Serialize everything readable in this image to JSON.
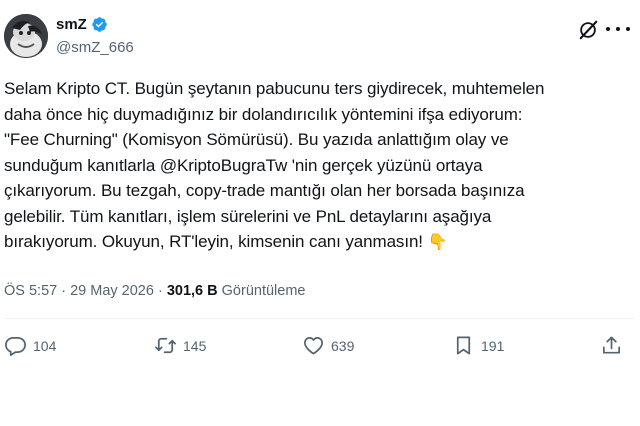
{
  "author": {
    "name": "smZ",
    "handle": "@smZ_666"
  },
  "post": {
    "lines": [
      "Selam Kripto CT. Bugün şeytanın pabucunu ters giydirecek, muhtemelen",
      "daha önce hiç duymadığınız bir dolandırıcılık yöntemini ifşa ediyorum:",
      "\"Fee Churning\" (Komisyon Sömürüsü). Bu yazıda anlattığım olay ve",
      "sunduğum kanıtlarla @KriptoBugraTw 'nin gerçek yüzünü ortaya",
      "çıkarıyorum. Bu tezgah, copy-trade mantığı olan her borsada başınıza",
      "gelebilir. Tüm kanıtları, işlem sürelerini ve PnL detaylarını aşağıya",
      "bırakıyorum. Okuyun, RT'leyin, kimsenin canı yanmasın!"
    ],
    "emoji": "👇",
    "time": "ÖS 5:57",
    "separator": " · ",
    "date": "29 May 2026",
    "views_count": "301,6 B",
    "views_label": "Görüntüleme"
  },
  "actions": {
    "replies": "104",
    "reposts": "145",
    "likes": "639",
    "bookmarks": "191"
  },
  "colors": {
    "verified": "#1d9bf0",
    "muted": "#536471",
    "text": "#0f1419"
  },
  "icons": [
    "verified-badge-icon",
    "grok-icon",
    "more-icon",
    "reply-icon",
    "repost-icon",
    "like-icon",
    "bookmark-icon",
    "share-icon"
  ]
}
